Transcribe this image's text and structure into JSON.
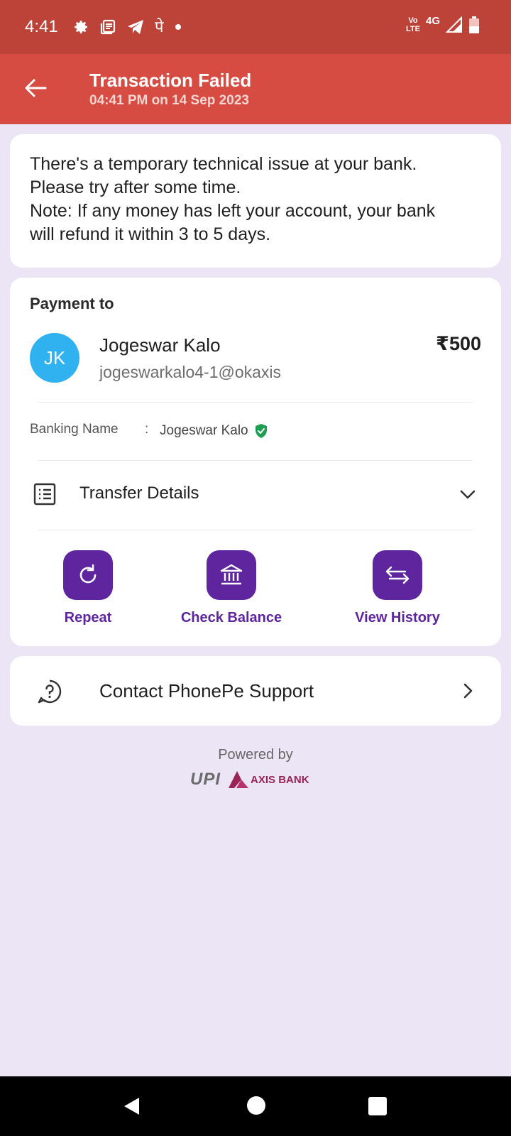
{
  "status_bar": {
    "time": "4:41",
    "icons_left": [
      "gear-icon",
      "news-icon",
      "telegram-icon",
      "phonepe-icon",
      "dot-icon"
    ],
    "phonepe_glyph": "पे",
    "volte": [
      "Vo",
      "LTE"
    ],
    "network": "4G"
  },
  "header": {
    "title": "Transaction Failed",
    "subtitle": "04:41 PM on 14 Sep 2023",
    "color": "#d64c42"
  },
  "message": {
    "line1": "There's a temporary technical issue at your bank.",
    "line2": "Please try after some time.",
    "line3": "Note: If any money has left your account, your bank",
    "line4": "will refund it within 3 to 5 days."
  },
  "payment": {
    "label": "Payment to",
    "avatar_initials": "JK",
    "payee_name": "Jogeswar Kalo",
    "payee_upi": "jogeswarkalo4-1@okaxis",
    "amount": "₹500",
    "banking_name_label": "Banking Name",
    "banking_colon": ":",
    "banking_name": "Jogeswar Kalo",
    "transfer_details_label": "Transfer Details"
  },
  "actions": [
    {
      "label": "Repeat",
      "icon": "refresh-icon"
    },
    {
      "label": "Check Balance",
      "icon": "bank-icon"
    },
    {
      "label": "View History",
      "icon": "swap-arrows-icon"
    }
  ],
  "support": {
    "label": "Contact PhonePe Support"
  },
  "footer": {
    "powered_by": "Powered by",
    "upi_logo": "UPI",
    "bank_logo": "AXIS BANK"
  },
  "colors": {
    "status_bar": "#bd4238",
    "accent": "#5f259f",
    "background": "#ece5f6"
  }
}
